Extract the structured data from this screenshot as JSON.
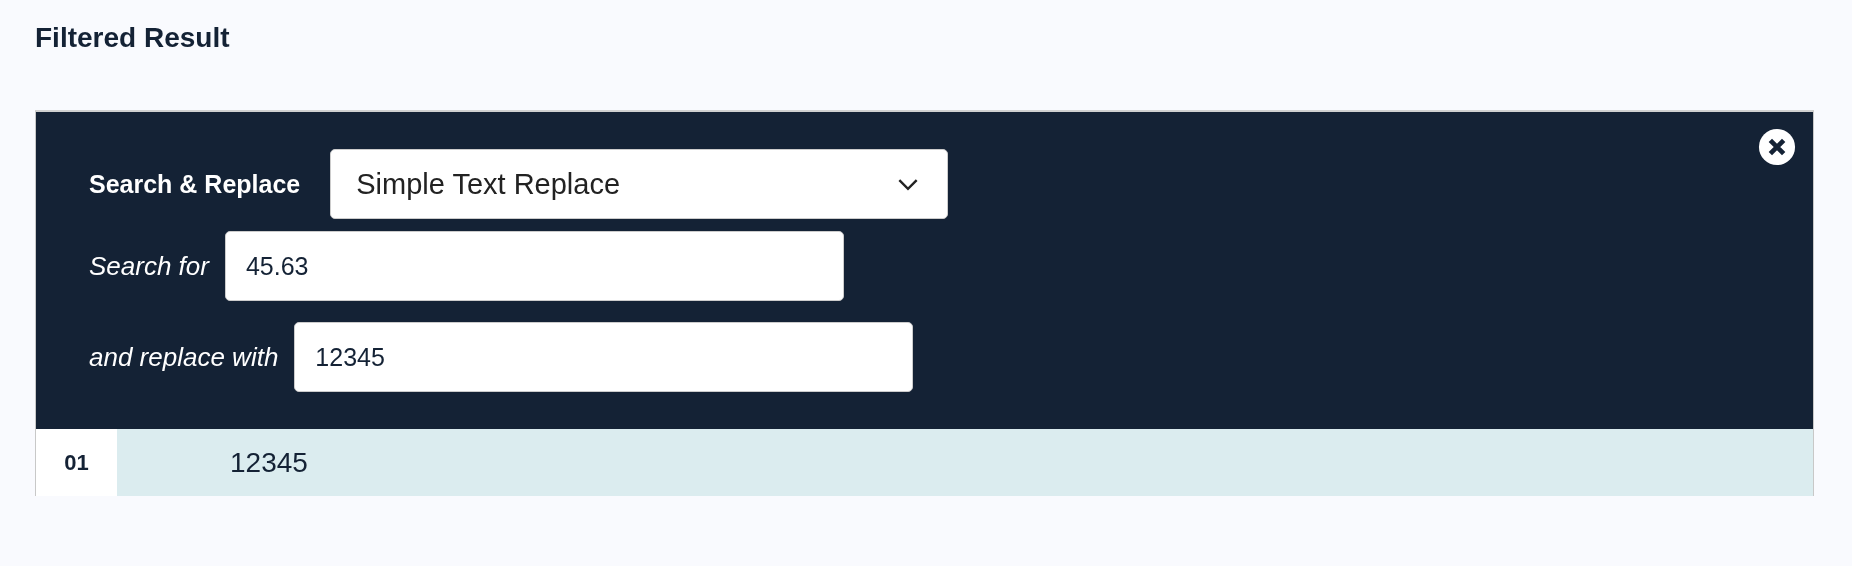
{
  "heading": "Filtered Result",
  "panel": {
    "title": "Search & Replace",
    "mode": {
      "value": "Simple Text Replace"
    },
    "fields": [
      {
        "label": "Search for",
        "value": "45.63"
      },
      {
        "label": "and replace with",
        "value": "12345"
      }
    ]
  },
  "rows": [
    {
      "number": "01",
      "text": "12345"
    }
  ]
}
